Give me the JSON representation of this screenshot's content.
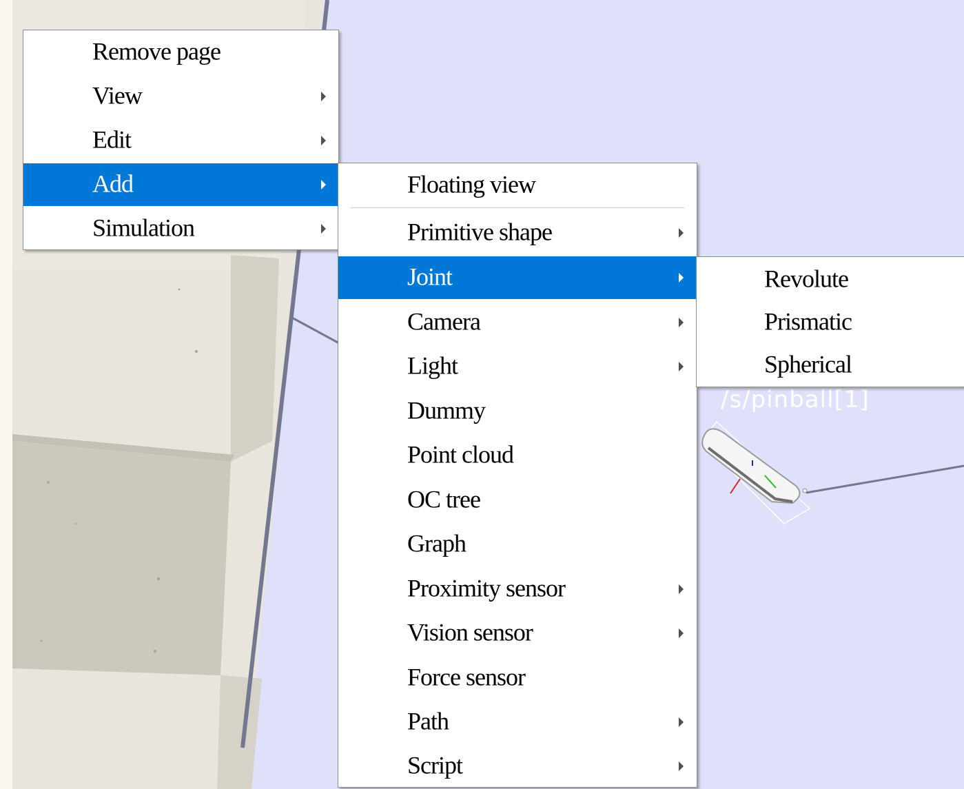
{
  "scene": {
    "object_label": "/s/pinball[1]",
    "colors": {
      "background": "#dfe0f9",
      "floor_light": "#ece8e0",
      "floor_dark": "#cfccc1",
      "menu_highlight": "#0078d7"
    }
  },
  "main_menu": {
    "items": [
      {
        "label": "Remove page",
        "submenu": false
      },
      {
        "label": "View",
        "submenu": true
      },
      {
        "label": "Edit",
        "submenu": true
      },
      {
        "label": "Add",
        "submenu": true,
        "highlighted": true
      },
      {
        "label": "Simulation",
        "submenu": true
      }
    ]
  },
  "add_menu": {
    "items": [
      {
        "label": "Floating view",
        "submenu": false
      },
      {
        "label": "Primitive shape",
        "submenu": true
      },
      {
        "label": "Joint",
        "submenu": true,
        "highlighted": true
      },
      {
        "label": "Camera",
        "submenu": true
      },
      {
        "label": "Light",
        "submenu": true
      },
      {
        "label": "Dummy",
        "submenu": false
      },
      {
        "label": "Point cloud",
        "submenu": false
      },
      {
        "label": "OC tree",
        "submenu": false
      },
      {
        "label": "Graph",
        "submenu": false
      },
      {
        "label": "Proximity sensor",
        "submenu": true
      },
      {
        "label": "Vision sensor",
        "submenu": true
      },
      {
        "label": "Force sensor",
        "submenu": false
      },
      {
        "label": "Path",
        "submenu": true
      },
      {
        "label": "Script",
        "submenu": true
      }
    ]
  },
  "joint_menu": {
    "items": [
      {
        "label": "Revolute"
      },
      {
        "label": "Prismatic"
      },
      {
        "label": "Spherical"
      }
    ]
  }
}
